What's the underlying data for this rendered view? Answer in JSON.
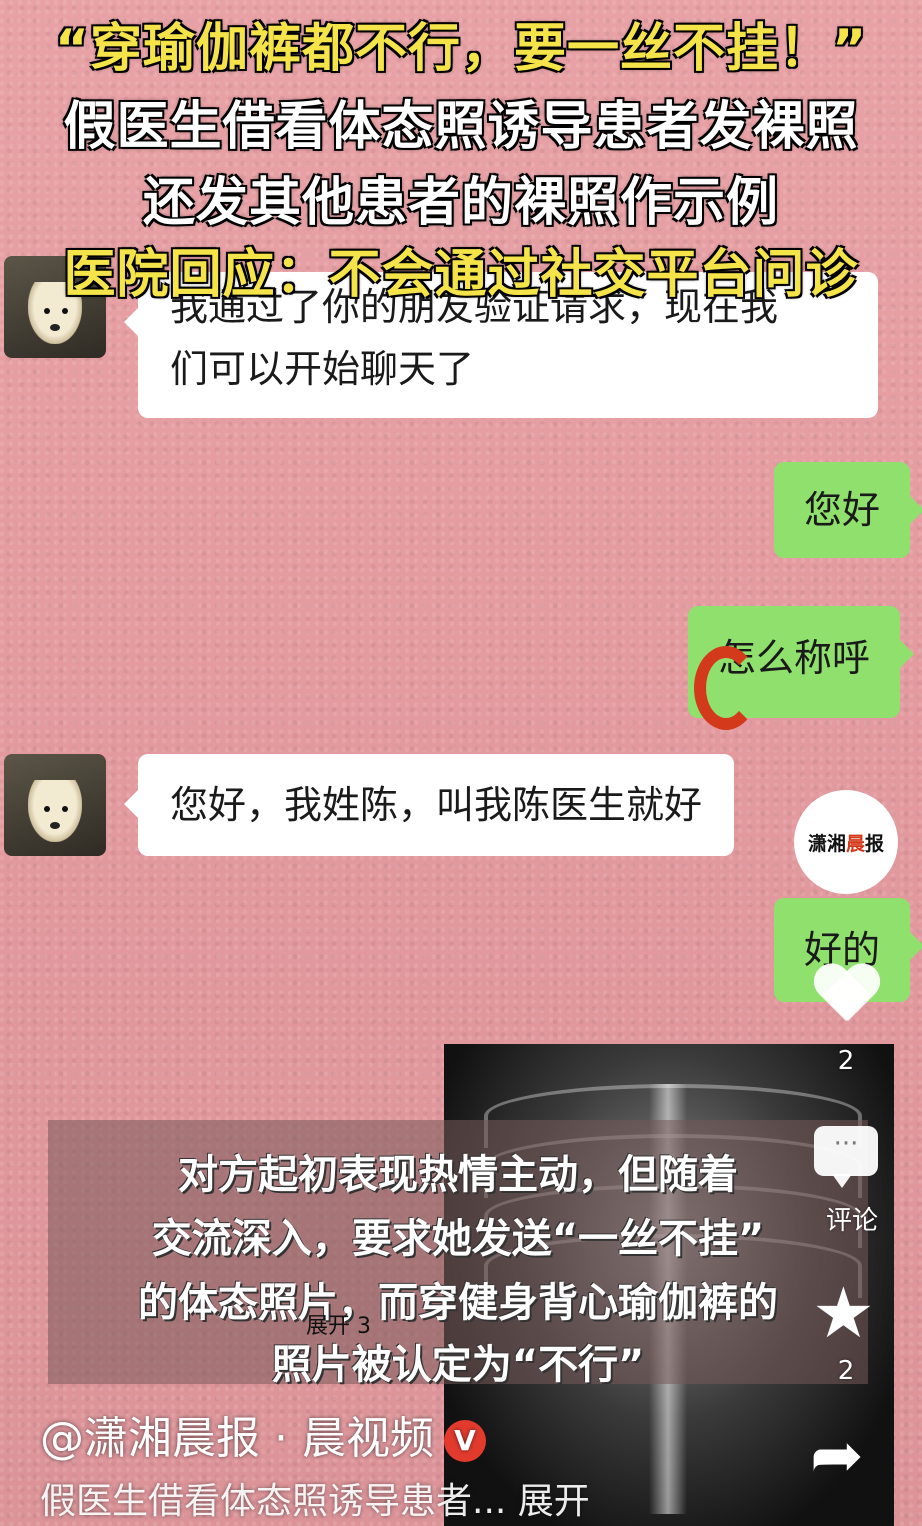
{
  "headline": {
    "line1": "“穿瑜伽裤都不行，要一丝不挂！”",
    "line2": "假医生借看体态照诱导患者发裸照",
    "line3": "还发其他患者的裸照作示例",
    "line4": "医院回应：不会通过社交平台问诊"
  },
  "chat": {
    "msg1_line1": "我通过了你的朋友验证请求，现在我",
    "msg1_line2": "们可以开始聊天了",
    "msg2": "您好",
    "msg3": "怎么称呼",
    "msg4": "您好，我姓陈，叫我陈医生就好",
    "msg5": "好的"
  },
  "watermark": {
    "brand_part1": "潇湘",
    "brand_part2": "晨",
    "brand_part3": "报"
  },
  "caption": {
    "line1": "对方起初表现热情主动，但随着",
    "line2": "交流深入，要求她发送“一丝不挂”",
    "line3": "的体态照片，而穿健身背心瑜伽裤的",
    "line4": "照片被认定为“不行”",
    "expand_label": "展开 3"
  },
  "sidebar": {
    "like_count": "2",
    "comment_label": "评论",
    "favorite_count": "2"
  },
  "footer": {
    "author": "@潇湘晨报 · 晨视频",
    "verified_badge": "V",
    "description": "假医生借看体态照诱导患者... 展开"
  },
  "colors": {
    "wall": "#e6a0a4",
    "bubble_out": "#8fe06d",
    "headline_yellow": "#f4e44a",
    "brand_red": "#d33a1b"
  }
}
